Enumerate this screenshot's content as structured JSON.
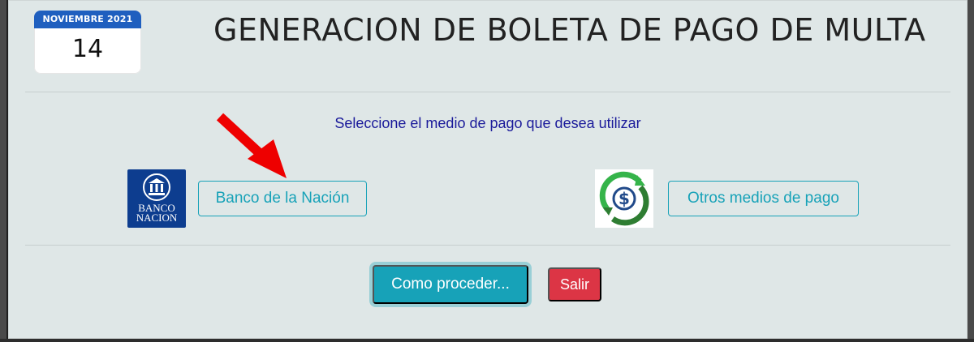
{
  "calendar": {
    "month_label": "NOVIEMBRE 2021",
    "day": "14"
  },
  "page": {
    "title": "GENERACION DE BOLETA DE PAGO DE MULTA",
    "instruction": "Seleccione el medio de pago que desea utilizar"
  },
  "options": {
    "bank_logo_text": "BANCO NACION",
    "bank_button": "Banco de la Nación",
    "other_button": "Otros medios de pago",
    "arrow_color": "#ee0000"
  },
  "actions": {
    "how_to_button": "Como proceder...",
    "exit_button": "Salir"
  },
  "colors": {
    "accent": "#17a2b8",
    "danger": "#dc3545",
    "bank_blue": "#0d3d8f",
    "calendar_blue": "#1f5fbf"
  },
  "icons": {
    "bank": "bank-building-icon",
    "other": "refresh-dollar-icon",
    "arrow": "red-arrow-icon"
  }
}
